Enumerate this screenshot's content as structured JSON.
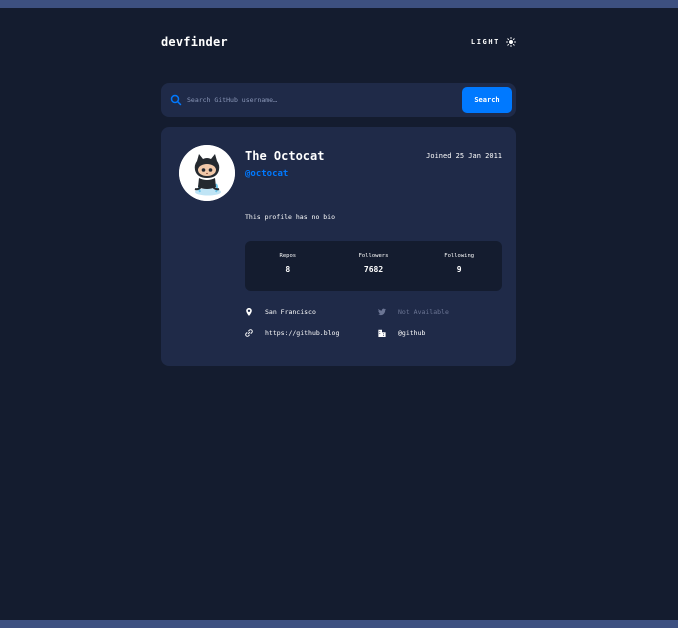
{
  "header": {
    "logo": "devfinder",
    "theme_label": "LIGHT",
    "theme_icon": "sun-icon"
  },
  "search": {
    "placeholder": "Search GitHub username…",
    "value": "",
    "button_label": "Search",
    "icon": "search-icon"
  },
  "profile": {
    "name": "The Octocat",
    "login": "@octocat",
    "joined": "Joined 25 Jan 2011",
    "bio": "This profile has no bio",
    "avatar_icon": "octocat-avatar",
    "stats": {
      "repos_label": "Repos",
      "repos_value": "8",
      "followers_label": "Followers",
      "followers_value": "7682",
      "following_label": "Following",
      "following_value": "9"
    },
    "links": {
      "location": "San Francisco",
      "twitter": "Not Available",
      "blog": "https://github.blog",
      "company": "@github"
    }
  },
  "colors": {
    "background": "#141c2f",
    "card": "#1f2a48",
    "accent": "#0079ff",
    "muted": "#6b7594"
  }
}
